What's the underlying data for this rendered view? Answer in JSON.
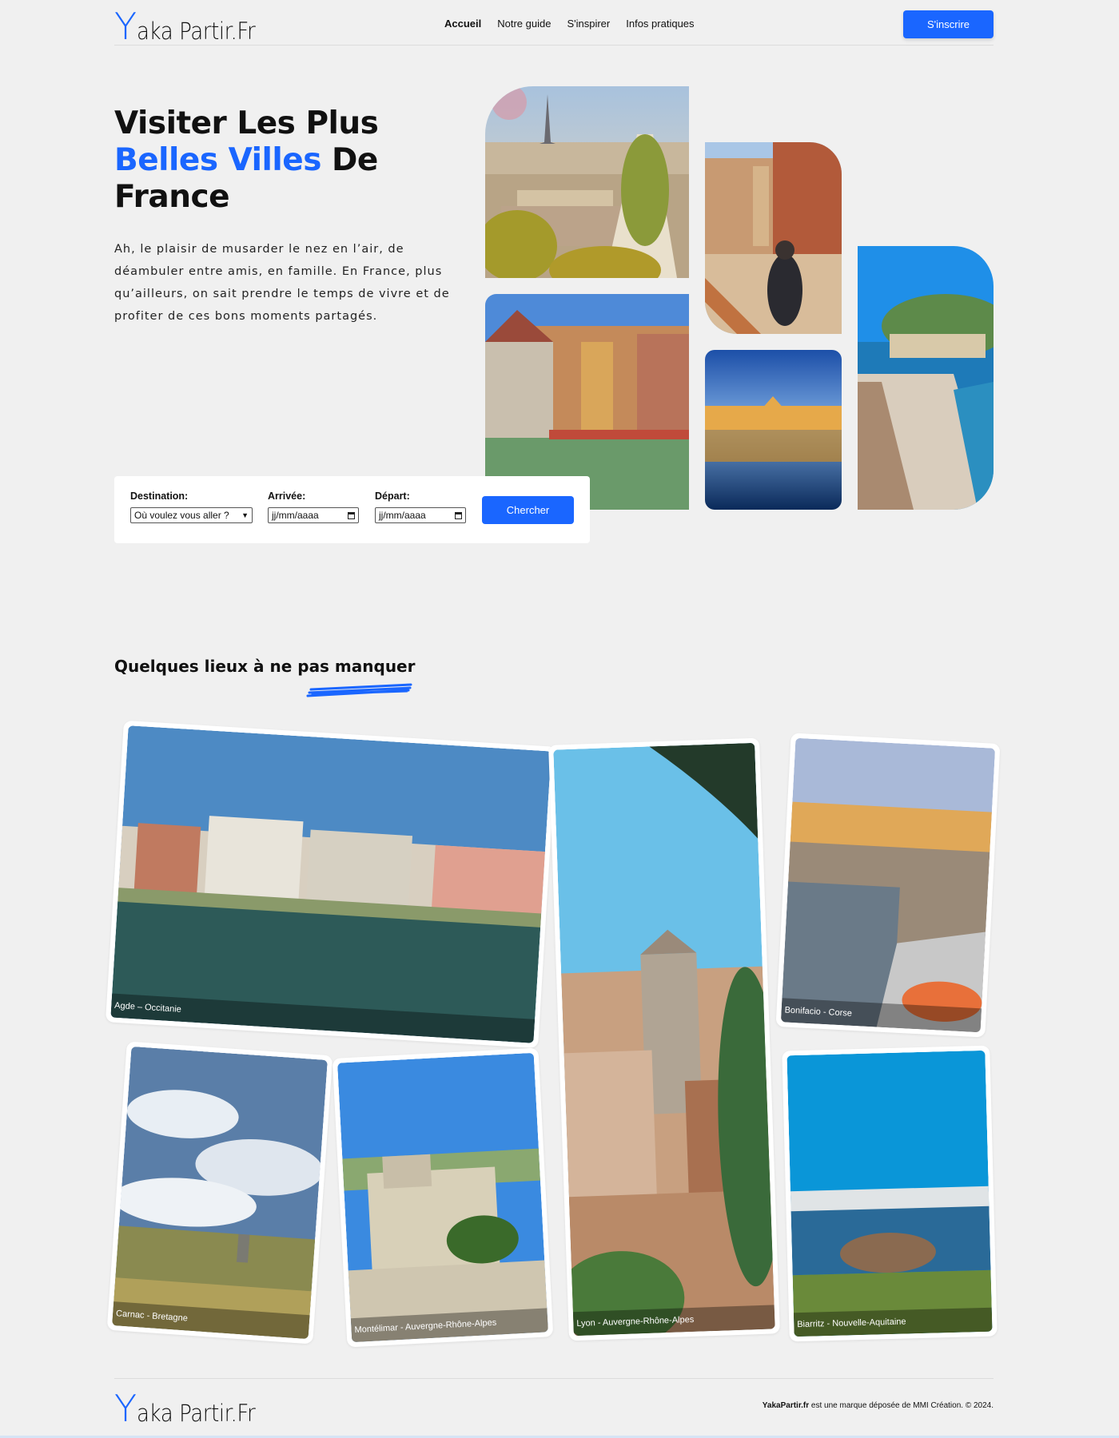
{
  "header": {
    "logo_y": "Y",
    "logo_rest": "aka Partir.Fr",
    "nav": [
      "Accueil",
      "Notre guide",
      "S'inspirer",
      "Infos pratiques"
    ],
    "signup_label": "S'inscrire"
  },
  "hero": {
    "title_line1": "Visiter Les Plus",
    "title_blue": "Belles Villes",
    "title_line2_rest": " De",
    "title_line3": "France",
    "text": "Ah, le plaisir de musarder le nez en l’air, de déambuler entre amis, en famille. En France, plus qu’ailleurs, on sait prendre le temps de vivre et de profiter de ces bons moments partagés."
  },
  "search": {
    "destination_label": "Destination:",
    "destination_value": "Où voulez vous aller ?",
    "arrival_label": "Arrivée:",
    "arrival_placeholder": "jj/mm/aaaa",
    "departure_label": "Départ:",
    "departure_placeholder": "jj/mm/aaaa",
    "button_label": "Chercher"
  },
  "places": {
    "title": "Quelques lieux à ne pas manquer",
    "cards": [
      "Agde – Occitanie",
      "Lyon - Auvergne-Rhône-Alpes",
      "Bonifacio - Corse",
      "Carnac - Bretagne",
      "Montélimar - Auvergne-Rhône-Alpes",
      "Biarritz - Nouvelle-Aquitaine"
    ]
  },
  "footer": {
    "brand": "YakaPartir.fr",
    "copyright": " est une marque déposée de MMI Création. © 2024."
  },
  "colors": {
    "accent": "#1a66ff",
    "background": "#f0f0f0"
  }
}
